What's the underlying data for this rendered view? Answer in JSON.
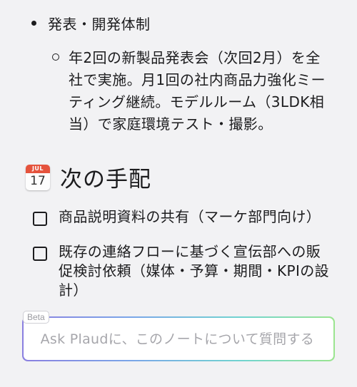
{
  "note": {
    "bullet": "発表・開発体制",
    "sub_bullet": "年2回の新製品発表会（次回2月）を全社で実施。月1回の社内商品力強化ミーティング継続。モデルルーム（3LDK相当）で家庭環境テスト・撮影。",
    "sub_bullet_lines": [
      "年2回の新製品発表会（次回2月）を全",
      "社で実施。月1回の社内商品力強化ミー",
      "ティング継続。モデルルーム（3LDK相",
      "当）で家庭環境テスト・撮影。"
    ],
    "heading": {
      "icon": "calendar-icon",
      "icon_month": "JUL",
      "icon_day": "17",
      "title": "次の手配"
    },
    "tasks": [
      {
        "label": "商品説明資料の共有（マーケ部門向け）",
        "lines": [
          "商品説明資料の共有（マーケ部門向け）"
        ],
        "checked": false
      },
      {
        "label": "既存の連絡フローに基づく宣伝部への販促検討依頼（媒体・予算・期間・KPIの設計）",
        "lines": [
          "既存の連絡フローに基づく宣伝部への販",
          "促検討依頼（媒体・予算・期間・KPIの設",
          "計）"
        ],
        "checked": false
      }
    ]
  },
  "ask": {
    "badge": "Beta",
    "placeholder": "Ask Plaudに、このノートについて質問する",
    "value": ""
  },
  "colors": {
    "background": "#f2f2f4",
    "text": "#1c1c1e",
    "calendar_red": "#e5533d",
    "gradient": [
      "#8a7fe0",
      "#7aa6e8",
      "#71d4d0",
      "#9be58f"
    ]
  }
}
